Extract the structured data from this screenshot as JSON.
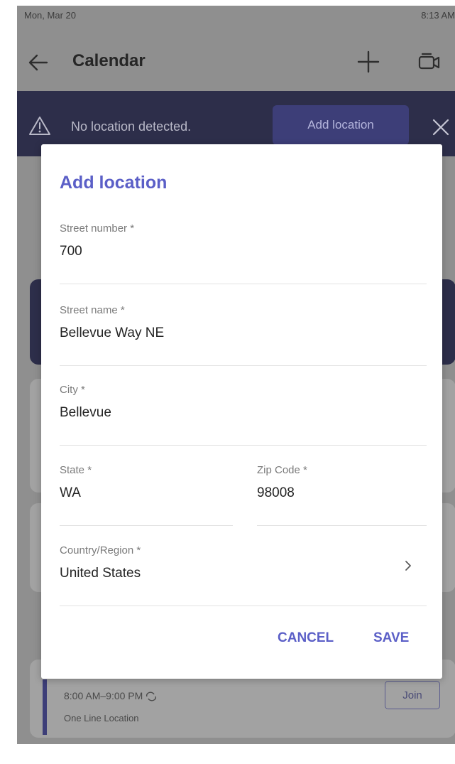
{
  "status_bar": {
    "date": "Mon, Mar 20",
    "time": "8:13 AM"
  },
  "app_bar": {
    "title": "Calendar"
  },
  "banner": {
    "message": "No location detected.",
    "add_location_button": "Add location",
    "background_color": "#2d2e4a"
  },
  "background_events": {
    "event_time": "8:00 AM–9:00 PM",
    "event_location": "One Line Location",
    "join_button": "Join"
  },
  "dialog": {
    "title": "Add location",
    "fields": {
      "street_number": {
        "label": "Street number *",
        "value": "700"
      },
      "street_name": {
        "label": "Street name *",
        "value": "Bellevue Way NE"
      },
      "city": {
        "label": "City *",
        "value": "Bellevue"
      },
      "state": {
        "label": "State *",
        "value": "WA"
      },
      "zip_code": {
        "label": "Zip Code *",
        "value": "98008"
      },
      "country_region": {
        "label": "Country/Region *",
        "value": "United States"
      }
    },
    "cancel_label": "CANCEL",
    "save_label": "SAVE",
    "accent_color": "#5b5fc7"
  },
  "icons": {
    "back": "arrow-left-icon",
    "add": "plus-icon",
    "camera": "video-camera-icon",
    "warning": "warning-triangle-icon",
    "close": "close-icon",
    "chevron": "chevron-right-icon",
    "recurrence": "repeat-icon"
  }
}
